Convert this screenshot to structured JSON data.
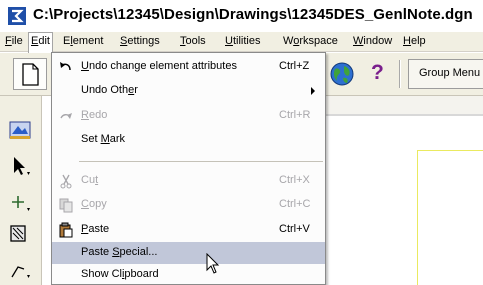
{
  "window": {
    "title": "C:\\Projects\\12345\\Design\\Drawings\\12345DES_GenlNote.dgn"
  },
  "menubar": {
    "items": [
      {
        "pre": "",
        "ul": "F",
        "post": "ile"
      },
      {
        "pre": "",
        "ul": "E",
        "post": "dit"
      },
      {
        "pre": "E",
        "ul": "l",
        "post": "ement"
      },
      {
        "pre": "",
        "ul": "S",
        "post": "ettings"
      },
      {
        "pre": "",
        "ul": "T",
        "post": "ools"
      },
      {
        "pre": "",
        "ul": "U",
        "post": "tilities"
      },
      {
        "pre": "W",
        "ul": "o",
        "post": "rkspace"
      },
      {
        "pre": "",
        "ul": "W",
        "post": "indow"
      },
      {
        "pre": "",
        "ul": "H",
        "post": "elp"
      }
    ]
  },
  "toolbar": {
    "group_menu_label": "Group Menu",
    "help_glyph": "?",
    "icons": [
      "new-file-icon",
      "globe-icon",
      "help-icon"
    ]
  },
  "edit_menu": {
    "items": [
      {
        "pre": "",
        "ul": "U",
        "post": "ndo change element attributes",
        "shortcut": "Ctrl+Z",
        "state": "enabled",
        "icon": "undo-icon"
      },
      {
        "pre": "Undo Oth",
        "ul": "e",
        "post": "r",
        "shortcut": "",
        "state": "enabled",
        "icon": "",
        "submenu": true
      },
      {
        "pre": "",
        "ul": "R",
        "post": "edo",
        "shortcut": "Ctrl+R",
        "state": "disabled",
        "icon": "redo-icon"
      },
      {
        "pre": "Set ",
        "ul": "M",
        "post": "ark",
        "shortcut": "",
        "state": "enabled",
        "icon": ""
      },
      {
        "pre": "Cu",
        "ul": "t",
        "post": "",
        "shortcut": "Ctrl+X",
        "state": "disabled",
        "icon": "cut-icon"
      },
      {
        "pre": "",
        "ul": "C",
        "post": "opy",
        "shortcut": "Ctrl+C",
        "state": "disabled",
        "icon": "copy-icon"
      },
      {
        "pre": "",
        "ul": "P",
        "post": "aste",
        "shortcut": "Ctrl+V",
        "state": "enabled",
        "icon": "paste-icon"
      },
      {
        "pre": "Paste ",
        "ul": "S",
        "post": "pecial...",
        "shortcut": "",
        "state": "highlighted",
        "icon": ""
      },
      {
        "pre": "Show Cl",
        "ul": "i",
        "post": "pboard",
        "shortcut": "",
        "state": "enabled",
        "icon": ""
      }
    ]
  },
  "colors": {
    "menu_highlight": "#c1c7d9",
    "disabled_text": "#a7a6aa",
    "chrome": "#f1efe2"
  }
}
